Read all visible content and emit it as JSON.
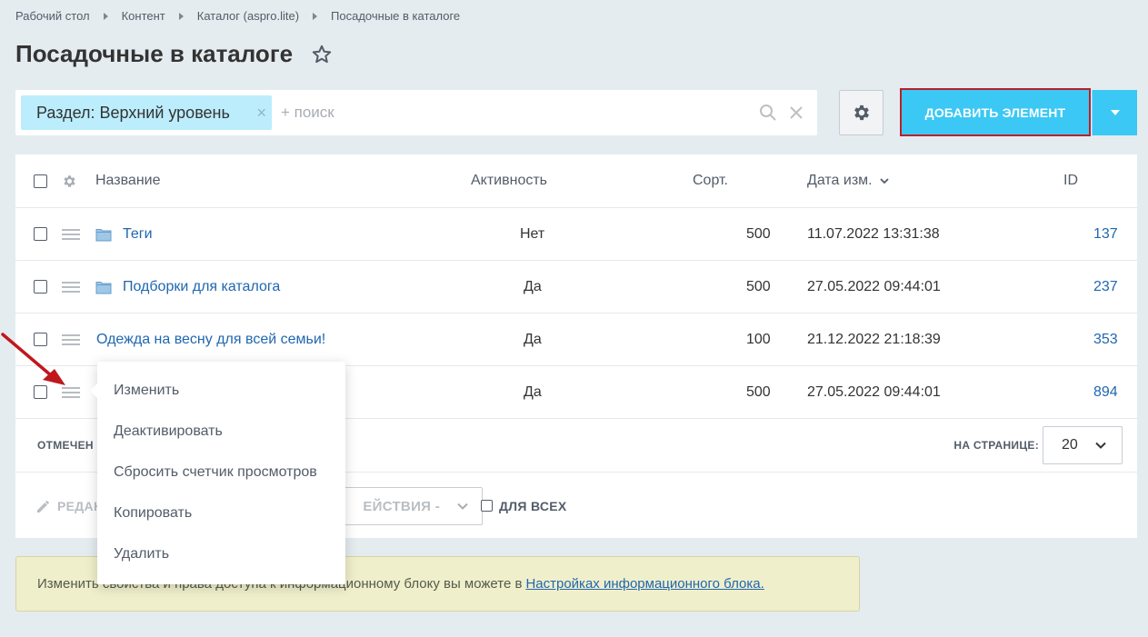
{
  "breadcrumbs": [
    "Рабочий стол",
    "Контент",
    "Каталог (aspro.lite)",
    "Посадочные в каталоге"
  ],
  "page": {
    "title": "Посадочные в каталоге"
  },
  "filter": {
    "tag": "Раздел: Верхний уровень",
    "tag_close": "×",
    "placeholder": "+ поиск"
  },
  "toolbar": {
    "add_label": "ДОБАВИТЬ ЭЛЕМЕНТ"
  },
  "table": {
    "headers": {
      "name": "Название",
      "active": "Активность",
      "sort": "Сорт.",
      "date": "Дата изм.",
      "id": "ID"
    },
    "rows": [
      {
        "name": "Теги",
        "folder": true,
        "active": "Нет",
        "sort": "500",
        "date": "11.07.2022 13:31:38",
        "id": "137"
      },
      {
        "name": "Подборки для каталога",
        "folder": true,
        "active": "Да",
        "sort": "500",
        "date": "27.05.2022 09:44:01",
        "id": "237"
      },
      {
        "name": "Одежда на весну для всей семьи!",
        "folder": false,
        "active": "Да",
        "sort": "100",
        "date": "21.12.2022 21:18:39",
        "id": "353"
      },
      {
        "name": "",
        "folder": false,
        "active": "Да",
        "sort": "500",
        "date": "27.05.2022 09:44:01",
        "id": "894"
      }
    ]
  },
  "footer": {
    "selected_label": "ОТМЕЧЕН",
    "per_page_label": "НА СТРАНИЦЕ:",
    "per_page_value": "20",
    "edit_label": "РЕДАК",
    "actions_label": "ЕЙСТВИЯ -",
    "for_all_label": "ДЛЯ ВСЕХ"
  },
  "notice": {
    "text": "Изменить свойства и права доступа к информационному блоку вы можете в",
    "link": "Настройках информационного блока."
  },
  "context_menu": {
    "items": [
      "Изменить",
      "Деактивировать",
      "Сбросить счетчик просмотров",
      "Копировать",
      "Удалить"
    ]
  },
  "colors": {
    "accent": "#3bc8f5",
    "highlight_border": "#b8202a",
    "arrow": "#c0171d",
    "link": "#2067b0"
  },
  "icons": [
    "chevron-right-icon",
    "star-icon",
    "close-icon",
    "search-icon",
    "gear-icon",
    "caret-down-icon",
    "folder-icon",
    "drag-handle-icon",
    "pencil-icon",
    "chevron-down-icon",
    "arrow-pointer-icon"
  ]
}
